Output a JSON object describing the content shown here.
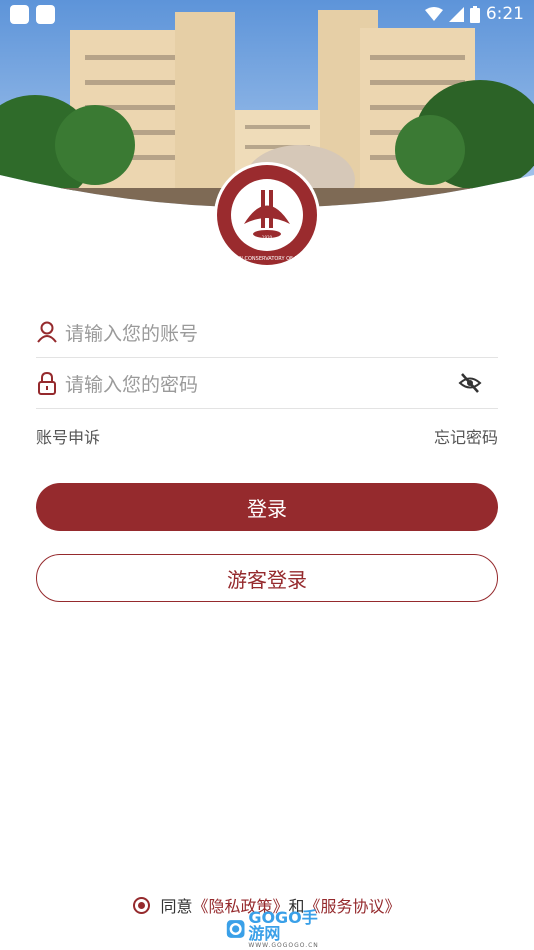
{
  "status_bar": {
    "time": "6:21"
  },
  "logo": {
    "text_ring": "WUHAN CONSERVATORY OF MUSIC",
    "year": "1920"
  },
  "login_form": {
    "account_placeholder": "请输入您的账号",
    "password_placeholder": "请输入您的密码",
    "account_appeal": "账号申诉",
    "forgot_password": "忘记密码",
    "login_label": "登录",
    "guest_login_label": "游客登录"
  },
  "agreement": {
    "prefix": "同意",
    "privacy_policy": "《隐私政策》",
    "and": "和",
    "service_agreement": "《服务协议》"
  },
  "watermark": {
    "brand": "GOGO手游网",
    "url": "WWW.GOGOGO.CN"
  },
  "colors": {
    "accent": "#952a2d",
    "placeholder": "#9a9a9a"
  }
}
